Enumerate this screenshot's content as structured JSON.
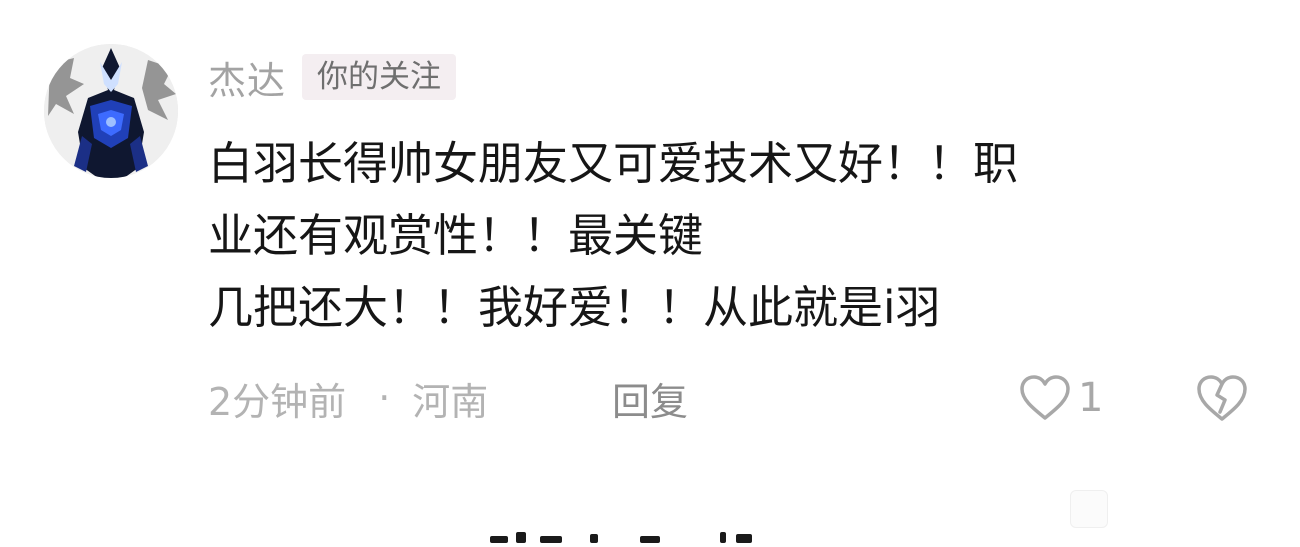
{
  "comment": {
    "username": "杰达",
    "follow_tag": "你的关注",
    "text_lines": [
      "白羽长得帅女朋友又可爱技术又好！！职",
      "业还有观赏性！！最关键",
      "几把还大！！我好爱！！从此就是i羽"
    ],
    "time": "2分钟前",
    "separator": "·",
    "location": "河南",
    "reply_label": "回复",
    "like_count": "1",
    "icons": {
      "avatar": "avatar-image",
      "like": "heart-outline-icon",
      "dislike": "broken-heart-icon"
    },
    "colors": {
      "username": "#a3a3a3",
      "tag_bg": "#f4eef1",
      "body_text": "#161616",
      "meta_text": "#b3b3b3"
    }
  }
}
